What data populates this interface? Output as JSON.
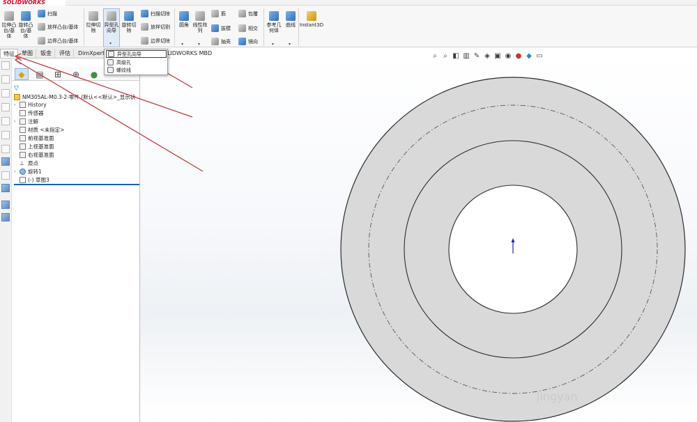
{
  "app": {
    "logo_text": "SOLIDWORKS"
  },
  "ribbon": {
    "extrude_boss": "拉伸凸\n台/基\n体",
    "revolve_boss": "旋转凸\n台/基\n体",
    "sweep": "扫描",
    "loft_boss": "放样凸台/基体",
    "boundary_boss": "边界凸台/基体",
    "extrude_cut": "拉伸切\n除",
    "hole_wizard": "异型孔\n向导",
    "revolve_cut": "旋转切\n除",
    "sweep_cut": "扫描切除",
    "loft_cut": "放样切割",
    "boundary_cut": "边界切除",
    "fillet": "圆角",
    "linear_pattern": "线性阵\n列",
    "rib": "筋",
    "draft": "拔模",
    "shell": "抽壳",
    "wrap": "包覆",
    "intersect": "相交",
    "mirror": "镜向",
    "ref_geometry": "参考几\n何体",
    "curves": "曲线",
    "instant3d": "Instant3D"
  },
  "tabs": [
    {
      "label": "特征"
    },
    {
      "label": "草图"
    },
    {
      "label": "钣金"
    },
    {
      "label": "评估"
    },
    {
      "label": "DimXpert"
    }
  ],
  "mbd_tab": "LIDWORKS MBD",
  "menu": {
    "items": [
      {
        "label": "异型孔向导"
      },
      {
        "label": "高级孔"
      },
      {
        "label": "螺纹线"
      }
    ]
  },
  "tree": {
    "part_name": "NM305AL-M0.3-2-零件 (默认<<默认>_显示状",
    "nodes": [
      {
        "label": "History"
      },
      {
        "label": "传感器"
      },
      {
        "label": "注解"
      },
      {
        "label": "材质 <未指定>"
      },
      {
        "label": "前视基准面"
      },
      {
        "label": "上视基准面"
      },
      {
        "label": "右视基准面"
      },
      {
        "label": "原点"
      },
      {
        "label": "旋转1"
      },
      {
        "label": "(-) 草图3"
      }
    ]
  },
  "watermark": "jingyan"
}
